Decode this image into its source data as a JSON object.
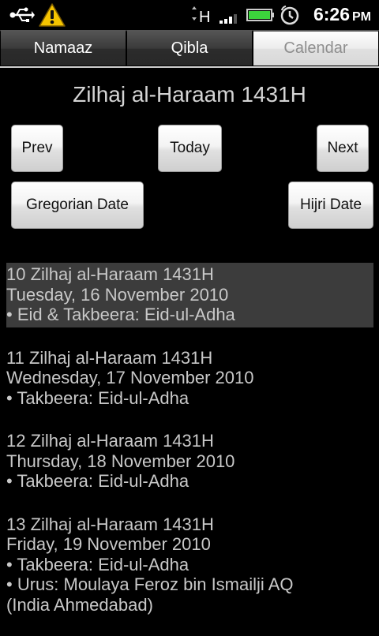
{
  "status_bar": {
    "time": "6:26",
    "ampm": "PM",
    "network": "H",
    "icons": [
      "usb-icon",
      "warning-icon",
      "signal-icon",
      "battery-icon",
      "alarm-icon"
    ]
  },
  "tabs": [
    {
      "label": "Namaaz",
      "active": false
    },
    {
      "label": "Qibla",
      "active": false
    },
    {
      "label": "Calendar",
      "active": true
    }
  ],
  "month_title": "Zilhaj al-Haraam 1431H",
  "buttons": {
    "prev": "Prev",
    "today": "Today",
    "next": "Next",
    "gregorian": "Gregorian Date",
    "hijri": "Hijri Date"
  },
  "days": [
    {
      "hijri": "10 Zilhaj al-Haraam 1431H",
      "gregorian": "Tuesday, 16 November 2010",
      "events": [
        "• Eid & Takbeera: Eid-ul-Adha"
      ],
      "selected": true
    },
    {
      "hijri": "11 Zilhaj al-Haraam 1431H",
      "gregorian": "Wednesday, 17 November 2010",
      "events": [
        "• Takbeera: Eid-ul-Adha"
      ],
      "selected": false
    },
    {
      "hijri": "12 Zilhaj al-Haraam 1431H",
      "gregorian": "Thursday, 18 November 2010",
      "events": [
        "• Takbeera: Eid-ul-Adha"
      ],
      "selected": false
    },
    {
      "hijri": "13 Zilhaj al-Haraam 1431H",
      "gregorian": "Friday, 19 November 2010",
      "events": [
        "• Takbeera: Eid-ul-Adha",
        "• Urus: Moulaya Feroz bin Ismailji AQ",
        "(India Ahmedabad)"
      ],
      "selected": false
    }
  ],
  "colors": {
    "background": "#000000",
    "battery": "#3cd23c",
    "warning": "#f5c400",
    "selected_row": "#3c3c3c"
  }
}
